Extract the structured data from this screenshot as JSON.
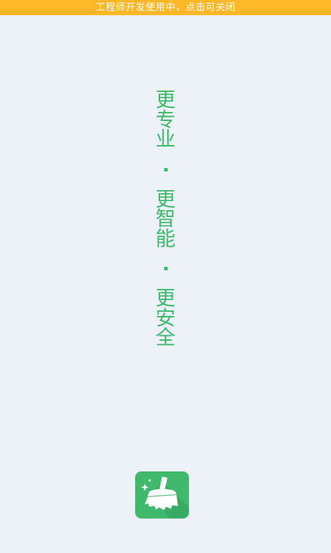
{
  "status_banner": {
    "text": "工程师开发使用中，点击可关闭"
  },
  "slogan": {
    "groups": [
      {
        "chars": [
          "更",
          "专",
          "业"
        ]
      },
      {
        "chars": [
          "更",
          "智",
          "能"
        ]
      },
      {
        "chars": [
          "更",
          "安",
          "全"
        ]
      }
    ]
  },
  "logo": {
    "icon": "broom-cleaner-icon",
    "background_color": "#3fb96c"
  },
  "colors": {
    "background": "#edf1f8",
    "banner": "#fdb727",
    "accent": "#3dba6a"
  }
}
